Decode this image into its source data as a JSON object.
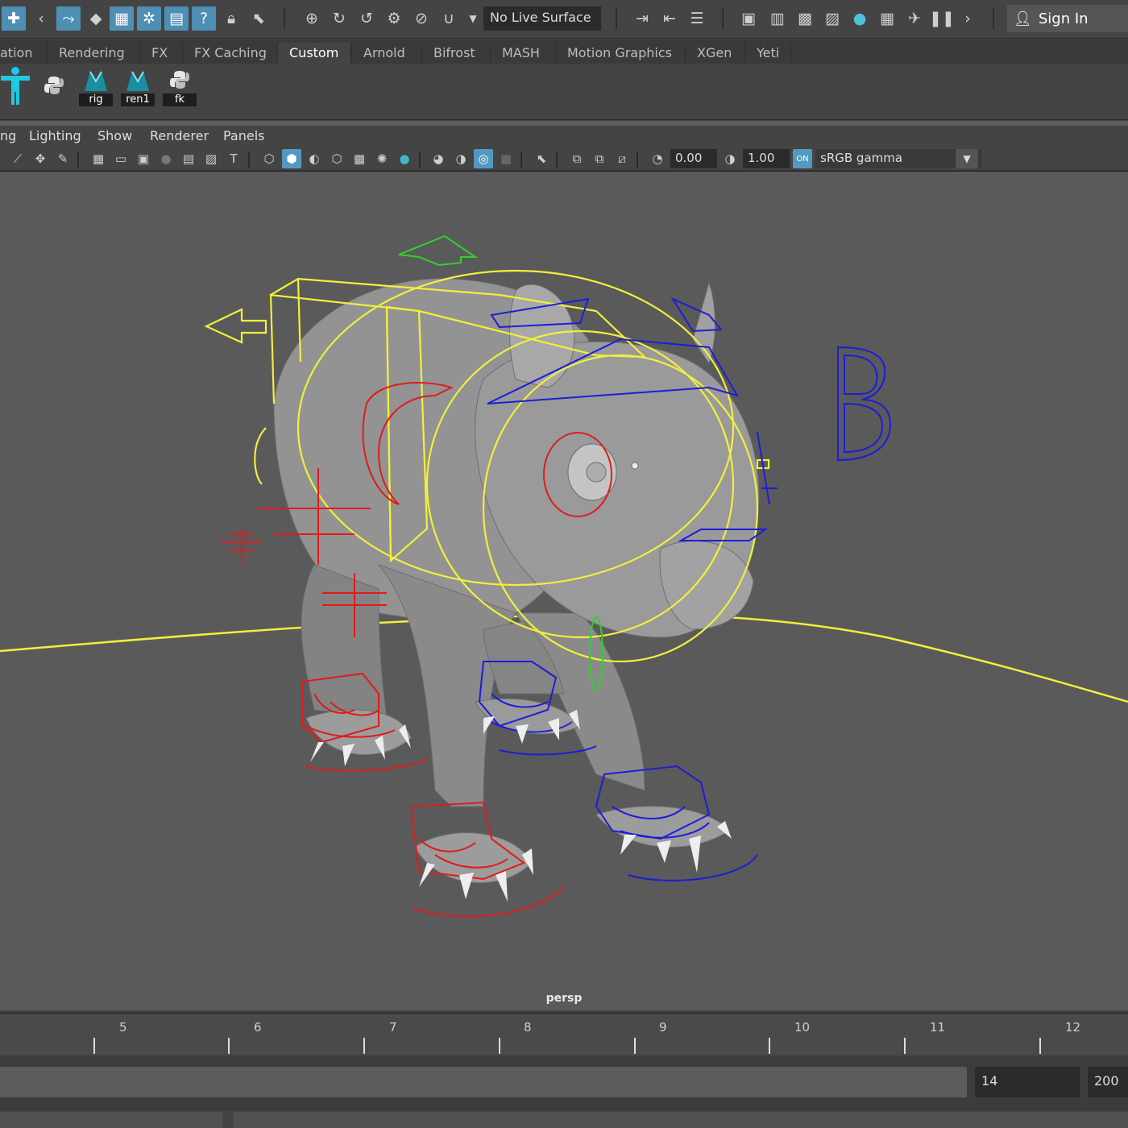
{
  "status_line": {
    "live_surface_label": "No Live Surface",
    "sign_in_label": "Sign In",
    "icons": [
      "select-tool-icon",
      "lasso-icon",
      "paint-select-icon",
      "snap-grid-icon",
      "snap-curve-icon",
      "snap-point-icon",
      "snap-view-icon",
      "snap-live-icon",
      "history-icon",
      "lock-icon",
      "cursor-icon",
      "render-frame-icon",
      "ipr-render-icon",
      "render-settings-icon",
      "hypershade-icon",
      "pause-icon"
    ]
  },
  "shelf_tabs": [
    "ation",
    "Rendering",
    "FX",
    "FX Caching",
    "Custom",
    "Arnold",
    "Bifrost",
    "MASH",
    "Motion Graphics",
    "XGen",
    "Yeti"
  ],
  "active_shelf_tab": "Custom",
  "shelf_buttons": [
    {
      "icon": "humanik-figure-icon",
      "label": ""
    },
    {
      "icon": "python-script-icon",
      "label": ""
    },
    {
      "icon": "rig-mel-icon",
      "label": "rig"
    },
    {
      "icon": "ren1-mel-icon",
      "label": "ren1"
    },
    {
      "icon": "python-script-icon",
      "label": "fk"
    }
  ],
  "panel_menu": [
    "ng",
    "Lighting",
    "Show",
    "Renderer",
    "Panels"
  ],
  "panel_toolbar": {
    "exposure": "0.00",
    "gamma": "1.00",
    "color_space": "sRGB gamma"
  },
  "viewport": {
    "camera_label": "persp",
    "annotation": "B"
  },
  "timeline": {
    "ticks": [
      "5",
      "6",
      "7",
      "8",
      "9",
      "10",
      "11",
      "12"
    ]
  },
  "range": {
    "current_frame": "14",
    "end_frame": "200"
  },
  "colors": {
    "accent": "#4e8fb3",
    "ctrl_yellow": "#f2ef3c",
    "ctrl_red": "#e01b1b",
    "ctrl_blue": "#1d1dd8",
    "ctrl_green": "#2fd12f"
  }
}
